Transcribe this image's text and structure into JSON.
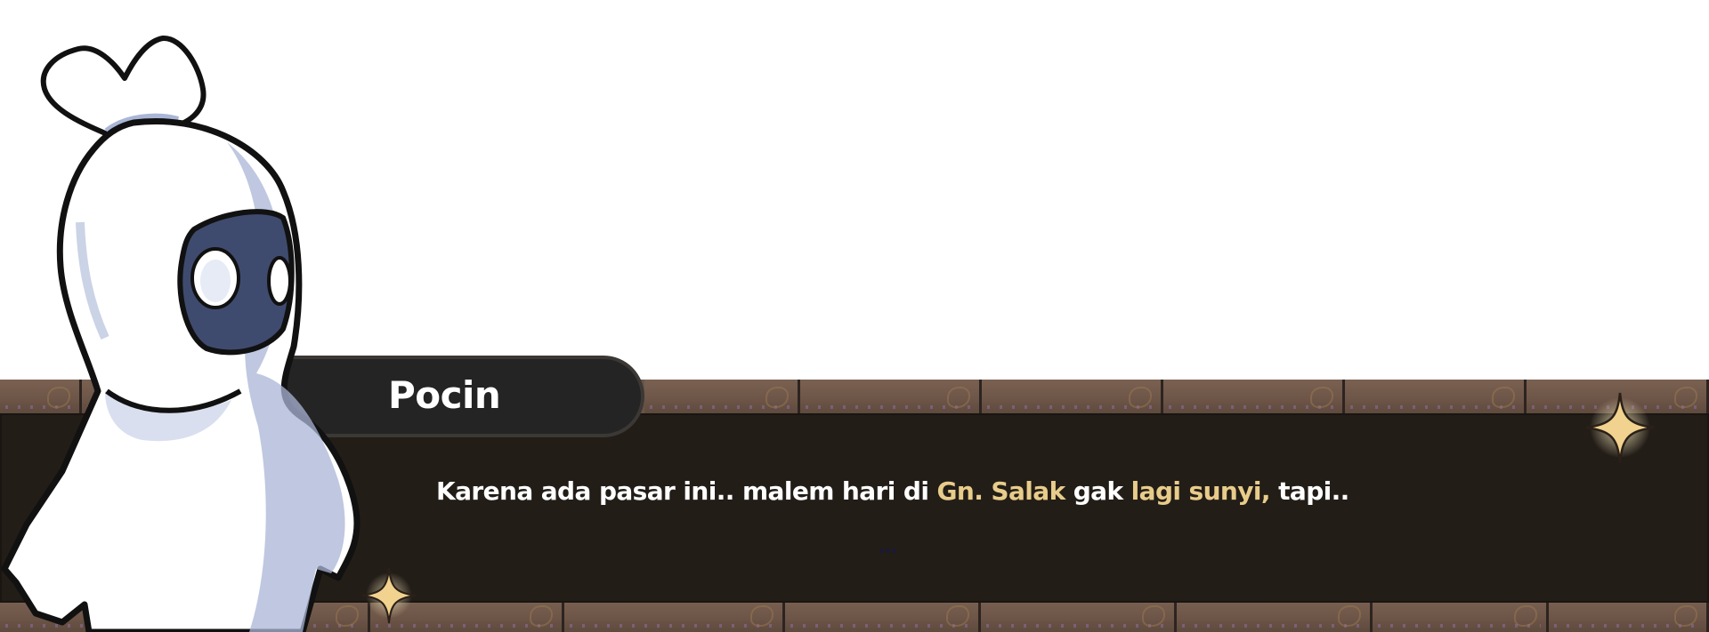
{
  "dialog": {
    "speaker": "Pocin",
    "line": {
      "part1": "Karena ada pasar ini.. malem hari di ",
      "highlight1": "Gn. Salak",
      "part2": " gak ",
      "highlight2": "lagi sunyi,",
      "part3": " tapi.."
    },
    "highlight_color": "#e8cc8a",
    "continue_indicator": "continue-dots-icon"
  },
  "colors": {
    "panel": "#231d18",
    "name_tab": "#242424",
    "brick": "#6b5547",
    "sparkle": "#f1d28e"
  },
  "icons": [
    "sparkle-icon",
    "continue-dots-icon"
  ]
}
